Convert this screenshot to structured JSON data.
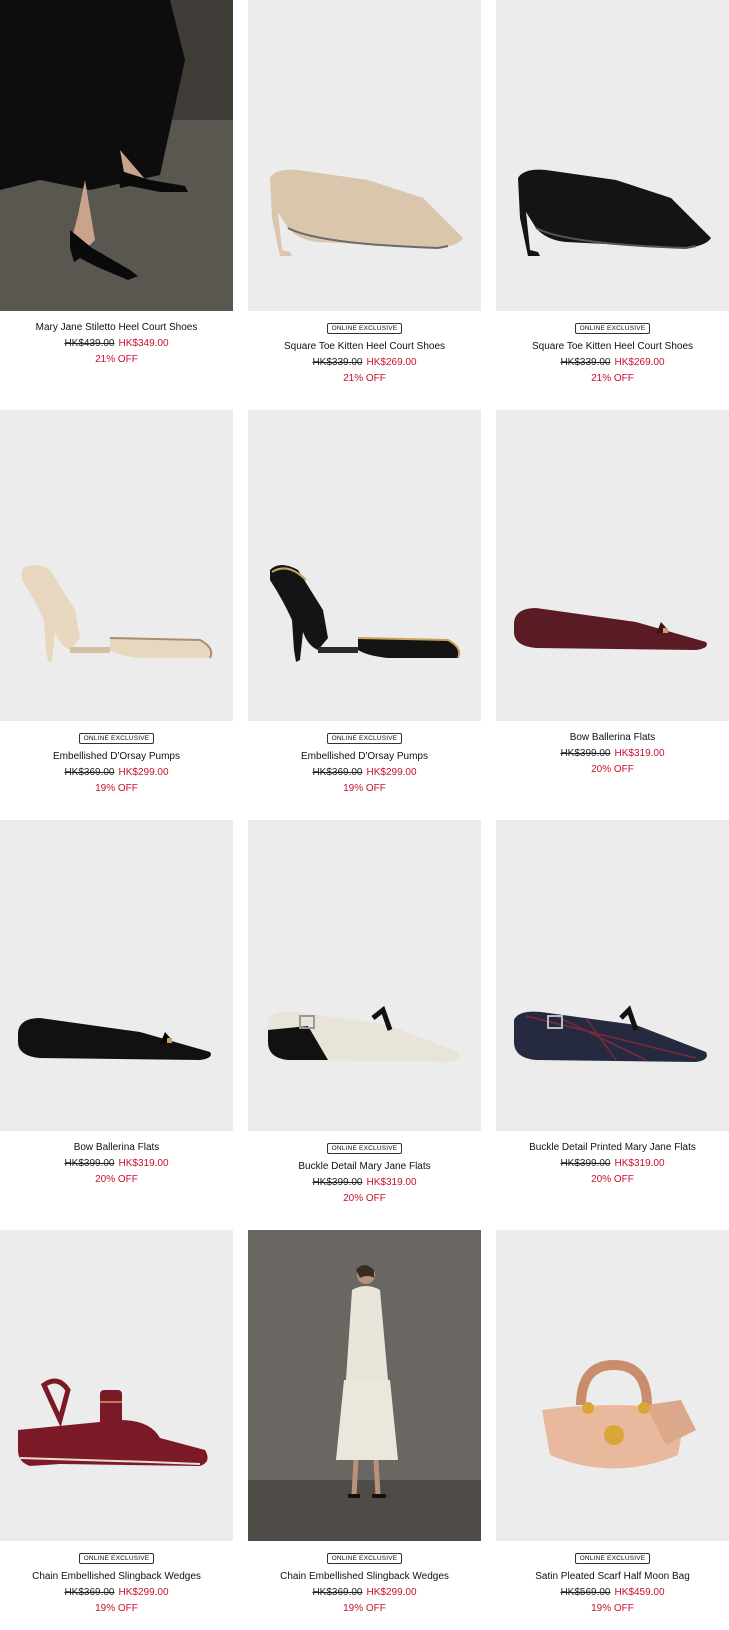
{
  "products": [
    {
      "name": "Mary Jane Stiletto Heel Court Shoes",
      "badge": "",
      "old_price": "HK$439.00",
      "new_price": "HK$349.00",
      "discount": "21% OFF"
    },
    {
      "name": "Square Toe Kitten Heel Court Shoes",
      "badge": "ONLINE EXCLUSIVE",
      "old_price": "HK$339.00",
      "new_price": "HK$269.00",
      "discount": "21% OFF"
    },
    {
      "name": "Square Toe Kitten Heel Court Shoes",
      "badge": "ONLINE EXCLUSIVE",
      "old_price": "HK$339.00",
      "new_price": "HK$269.00",
      "discount": "21% OFF"
    },
    {
      "name": "Embellished D'Orsay Pumps",
      "badge": "ONLINE EXCLUSIVE",
      "old_price": "HK$369.00",
      "new_price": "HK$299.00",
      "discount": "19% OFF"
    },
    {
      "name": "Embellished D'Orsay Pumps",
      "badge": "ONLINE EXCLUSIVE",
      "old_price": "HK$369.00",
      "new_price": "HK$299.00",
      "discount": "19% OFF"
    },
    {
      "name": "Bow Ballerina Flats",
      "badge": "",
      "old_price": "HK$399.00",
      "new_price": "HK$319.00",
      "discount": "20% OFF"
    },
    {
      "name": "Bow Ballerina Flats",
      "badge": "",
      "old_price": "HK$399.00",
      "new_price": "HK$319.00",
      "discount": "20% OFF"
    },
    {
      "name": "Buckle Detail Mary Jane Flats",
      "badge": "ONLINE EXCLUSIVE",
      "old_price": "HK$399.00",
      "new_price": "HK$319.00",
      "discount": "20% OFF"
    },
    {
      "name": "Buckle Detail Printed Mary Jane Flats",
      "badge": "",
      "old_price": "HK$399.00",
      "new_price": "HK$319.00",
      "discount": "20% OFF"
    },
    {
      "name": "Chain Embellished Slingback Wedges",
      "badge": "ONLINE EXCLUSIVE",
      "old_price": "HK$369.00",
      "new_price": "HK$299.00",
      "discount": "19% OFF"
    },
    {
      "name": "Chain Embellished Slingback Wedges",
      "badge": "ONLINE EXCLUSIVE",
      "old_price": "HK$369.00",
      "new_price": "HK$299.00",
      "discount": "19% OFF"
    },
    {
      "name": "Satin Pleated Scarf Half Moon Bag",
      "badge": "ONLINE EXCLUSIVE",
      "old_price": "HK$569.00",
      "new_price": "HK$459.00",
      "discount": "19% OFF"
    }
  ],
  "colors": {
    "sale_red": "#c8102e",
    "image_bg": "#ececec"
  }
}
